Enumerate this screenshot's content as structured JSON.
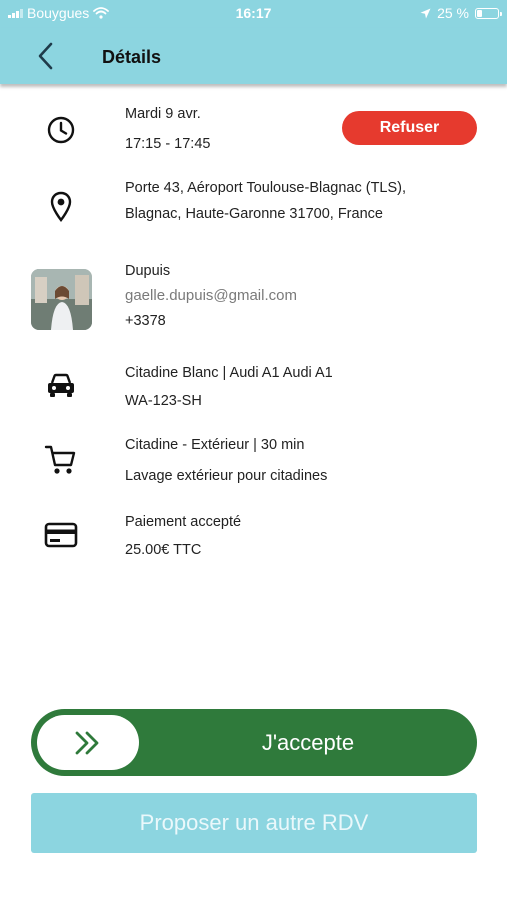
{
  "status_bar": {
    "carrier": "Bouygues",
    "time": "16:17",
    "battery_percent": "25 %",
    "battery_level": 0.25
  },
  "header": {
    "title": "Détails",
    "back_icon": "chevron-left-icon"
  },
  "appointment": {
    "date": "Mardi 9 avr.",
    "time_range": "17:15 - 17:45",
    "refuse_label": "Refuser",
    "icon": "clock-icon"
  },
  "location": {
    "line1": "Porte 43, Aéroport Toulouse-Blagnac (TLS),",
    "line2": "Blagnac, Haute-Garonne 31700, France",
    "icon": "location-pin-icon"
  },
  "customer": {
    "name": "Dupuis",
    "email": "gaelle.dupuis@gmail.com",
    "phone": "+3378"
  },
  "vehicle": {
    "description": "Citadine Blanc | Audi A1 Audi A1",
    "plate": "WA-123-SH",
    "icon": "car-icon"
  },
  "service": {
    "title": "Citadine - Extérieur | 30 min",
    "description": "Lavage extérieur pour citadines",
    "icon": "cart-icon"
  },
  "payment": {
    "status": "Paiement accepté",
    "amount": "25.00€ TTC",
    "icon": "credit-card-icon"
  },
  "actions": {
    "accept_label": "J'accepte",
    "accept_icon": "double-chevron-right-icon",
    "propose_label": "Proposer un autre RDV"
  },
  "colors": {
    "header_bg": "#8cd5e0",
    "refuse_red": "#e63a2e",
    "accept_green": "#2f7a3b"
  }
}
